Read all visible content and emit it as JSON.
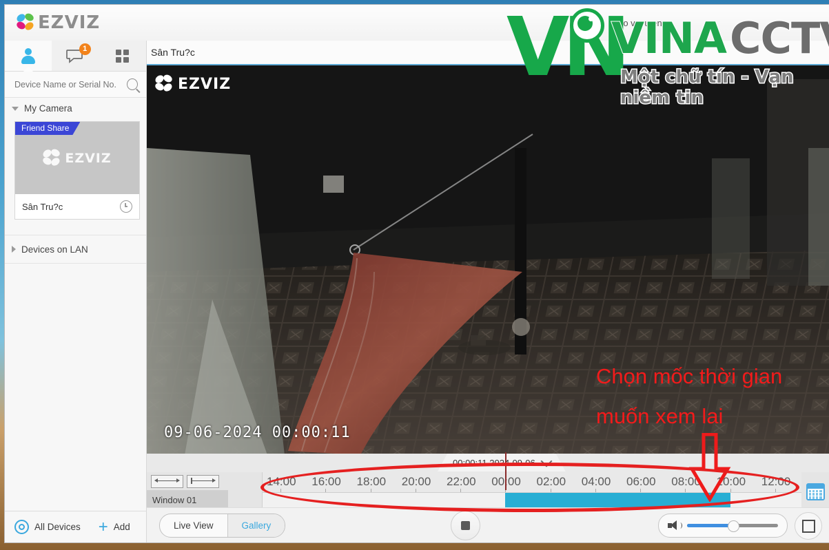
{
  "app": {
    "brand": "EZVIZ",
    "top_menu_hint": "dz   o  v c  u     enu"
  },
  "watermark": {
    "logo_letters": "VN",
    "name_primary": "VINA",
    "name_secondary": "CCTV",
    "tagline": "Một chữ tín - Vạn niềm tin"
  },
  "sidebar": {
    "icons": [
      {
        "name": "account-icon",
        "label": "Account"
      },
      {
        "name": "message-icon",
        "label": "Messages",
        "badge": "1"
      },
      {
        "name": "grid-icon",
        "label": "Apps"
      }
    ],
    "search": {
      "placeholder": "Device Name or Serial No.",
      "value": ""
    },
    "groups": [
      {
        "label": "My Camera",
        "expanded": true
      },
      {
        "label": "Devices on LAN",
        "expanded": false
      }
    ],
    "camera": {
      "share_tag": "Friend Share",
      "thumb_brand": "EZVIZ",
      "name": "Sân Tru?c",
      "history_icon": "clock-icon"
    },
    "footer": {
      "all_devices": "All Devices",
      "add": "Add"
    }
  },
  "main": {
    "camera_title": "Sân Tru?c",
    "video": {
      "overlay_brand": "EZVIZ",
      "timestamp": "09-06-2024 00:00:11"
    },
    "annotation": {
      "line1": "Chọn mốc thời gian",
      "line2": "muốn xem lai",
      "color": "#f21b1b",
      "arrow": "down-arrow-annotation",
      "ellipse": "timeline-highlight-ellipse"
    },
    "time_selector": {
      "value": "00:00:11 2024-09-06",
      "chevron": "chevron-down-icon"
    },
    "timeline": {
      "zoom_out_label": "zoom-out",
      "zoom_in_label": "zoom-in",
      "window_label": "Window 01",
      "ticks": [
        "14:00",
        "16:00",
        "18:00",
        "20:00",
        "22:00",
        "00:00",
        "02:00",
        "04:00",
        "06:00",
        "08:00",
        "10:00",
        "12:00"
      ],
      "recording_start_tick": "00:00",
      "recording_end_tick": "10:00",
      "calendar_icon": "calendar-icon"
    },
    "bottom": {
      "live_view": "Live View",
      "gallery": "Gallery",
      "selected_view": "Gallery",
      "stop_button": "stop-icon",
      "volume": {
        "level": 50,
        "icon": "speaker-icon"
      },
      "fullscreen": "fullscreen-icon"
    }
  },
  "colors": {
    "accent": "#3aa8de",
    "recording": "#28aed4",
    "badge": "#f2821a",
    "share": "#3b46d6",
    "annotation_red": "#e52020",
    "watermark_green": "#1ea64d"
  }
}
